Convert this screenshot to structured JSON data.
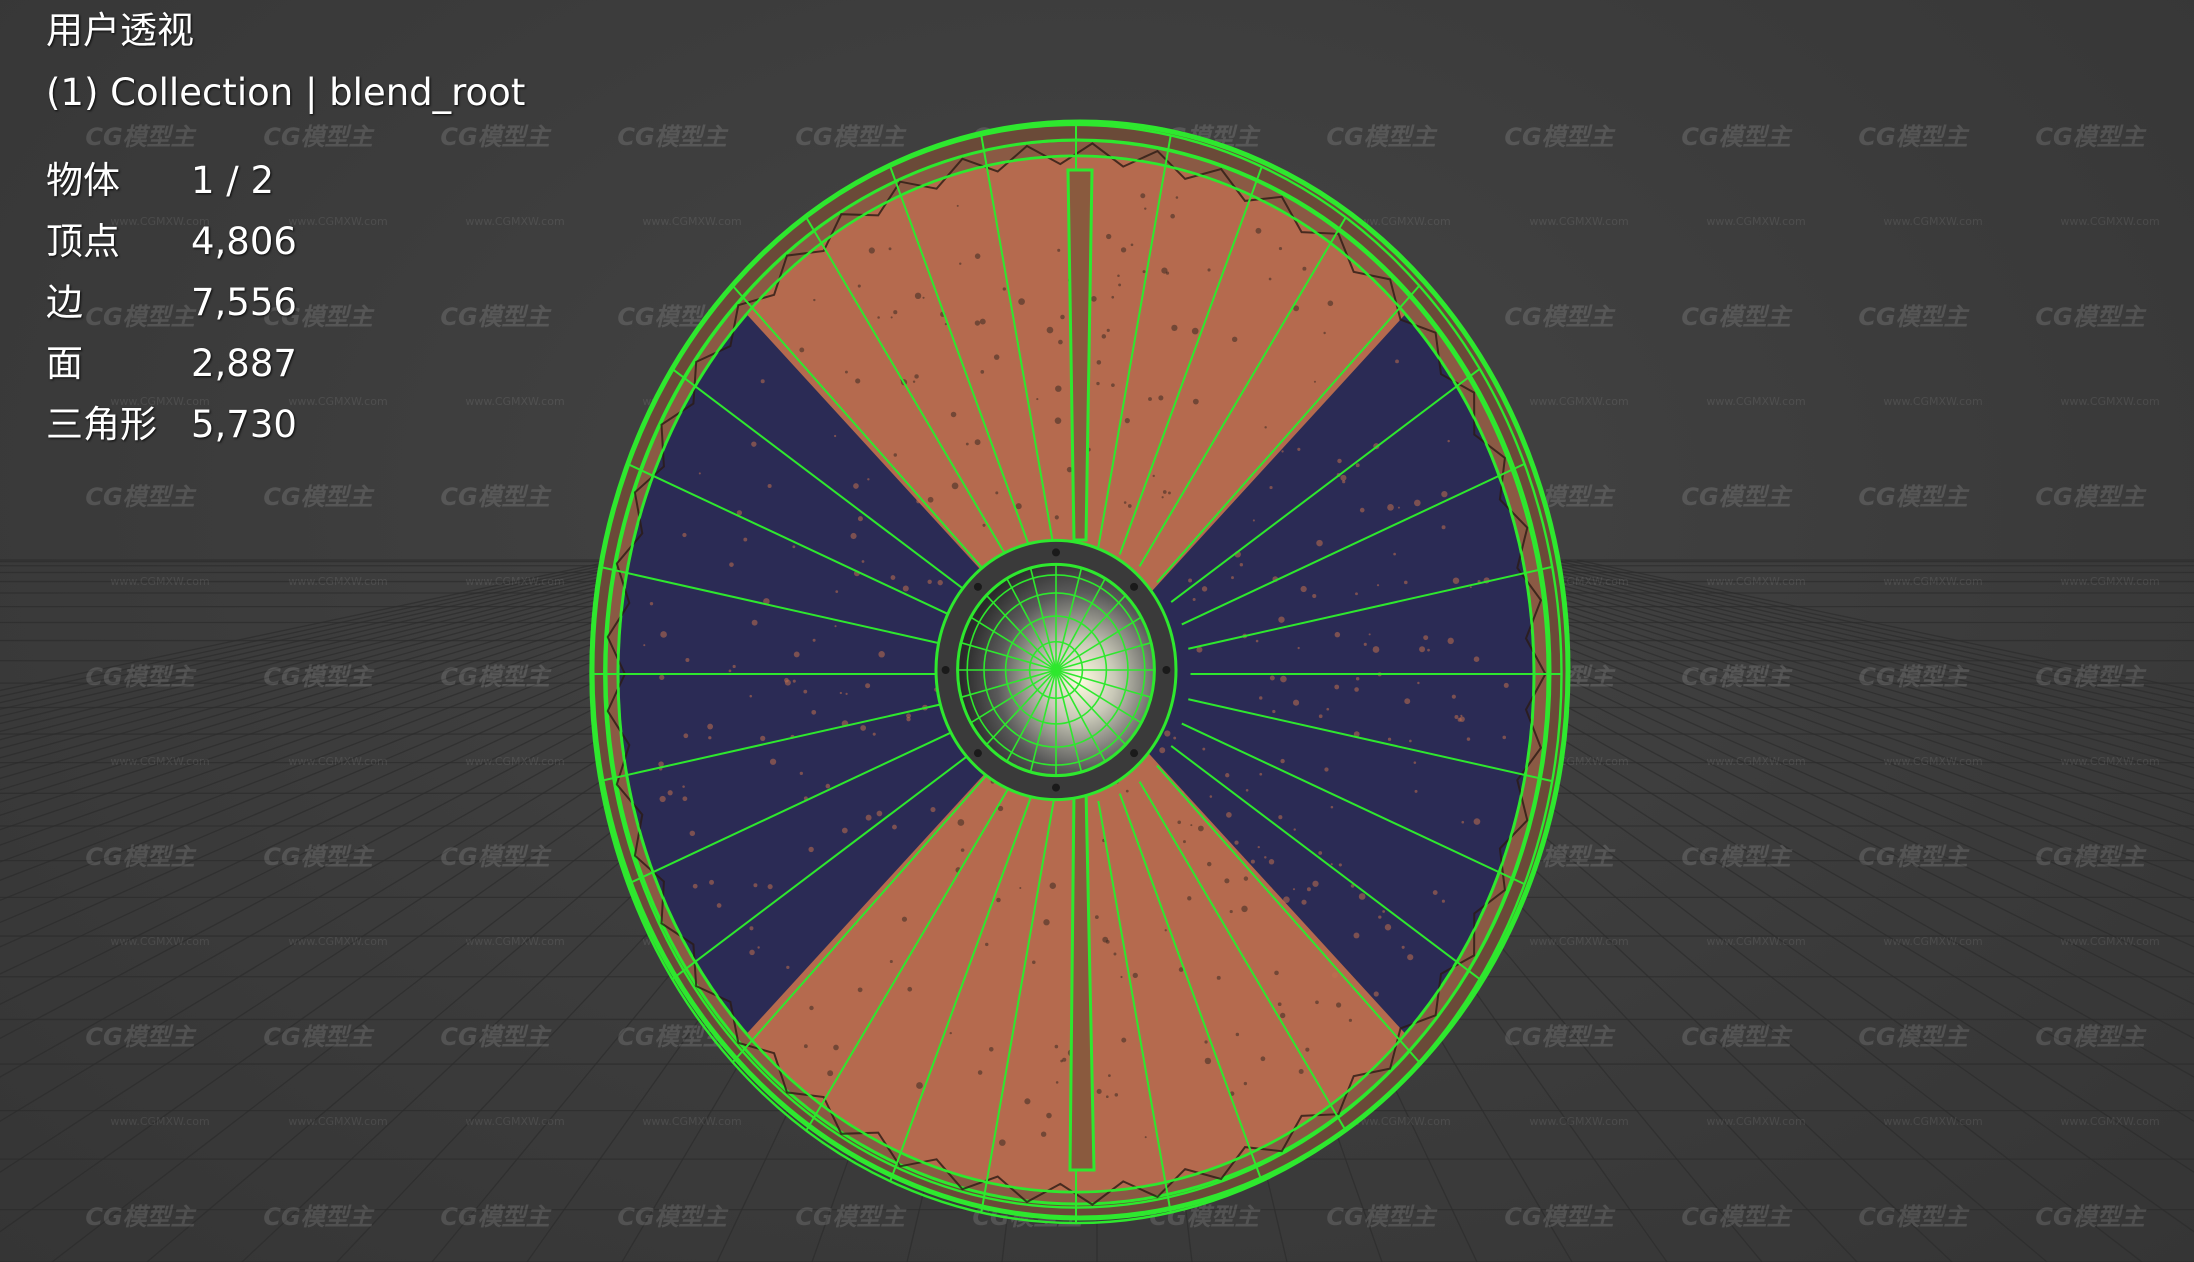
{
  "viewport": {
    "view_label": "用户透视",
    "collection_label": "(1) Collection | blend_root",
    "stats": [
      {
        "label": "物体",
        "value": "1 / 2"
      },
      {
        "label": "顶点",
        "value": "4,806"
      },
      {
        "label": "边",
        "value": "7,556"
      },
      {
        "label": "面",
        "value": "2,887"
      },
      {
        "label": "三角形",
        "value": "5,730"
      }
    ],
    "watermark_text": "CG模型主",
    "watermark_url": "www.CGMXW.com"
  },
  "colors": {
    "background": "#3d3d3d",
    "wireframe": "#2ee82e",
    "shield_red": "#b56a4e",
    "shield_blue": "#2b2b55",
    "grid": "#2c2c2c"
  },
  "scene": {
    "object": "round-shield-wireframe",
    "radial_segments": 32
  }
}
